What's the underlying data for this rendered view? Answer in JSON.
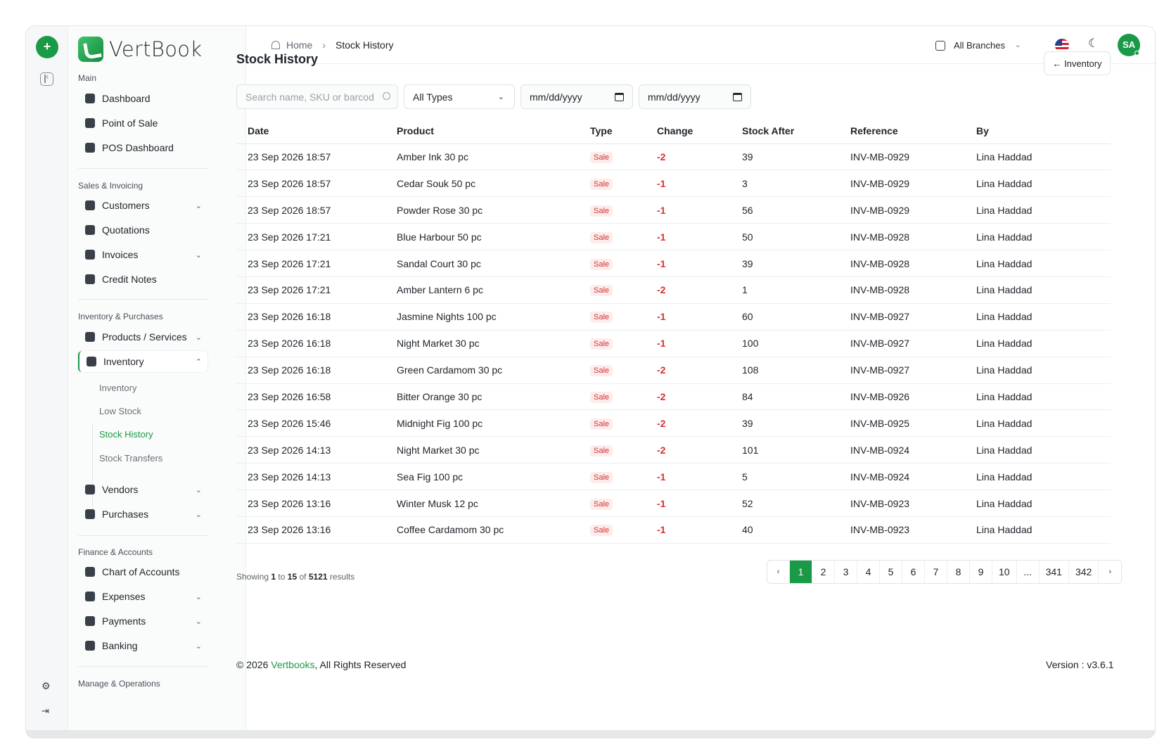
{
  "brand": {
    "name": "VertBook"
  },
  "sidebar": {
    "sections": [
      {
        "title": "Main"
      },
      {
        "title": "Sales & Invoicing"
      },
      {
        "title": "Inventory & Purchases"
      },
      {
        "title": "Finance & Accounts"
      },
      {
        "title": "Manage & Operations"
      }
    ],
    "items": [
      {
        "label": "Dashboard",
        "icon": "grid-icon"
      },
      {
        "label": "Point of Sale",
        "icon": "pos-icon"
      },
      {
        "label": "POS Dashboard",
        "icon": "chart-icon"
      },
      {
        "label": "Customers",
        "icon": "users-icon"
      },
      {
        "label": "Quotations",
        "icon": "quote-icon"
      },
      {
        "label": "Invoices",
        "icon": "invoice-icon"
      },
      {
        "label": "Credit Notes",
        "icon": "credit-note-icon"
      },
      {
        "label": "Products / Services",
        "icon": "box-icon"
      },
      {
        "label": "Inventory",
        "icon": "inventory-icon"
      },
      {
        "label": "Vendors",
        "icon": "vendor-icon"
      },
      {
        "label": "Purchases",
        "icon": "bag-icon"
      },
      {
        "label": "Chart of Accounts",
        "icon": "accounts-icon"
      },
      {
        "label": "Expenses",
        "icon": "expense-icon"
      },
      {
        "label": "Payments",
        "icon": "payment-icon"
      },
      {
        "label": "Banking",
        "icon": "bank-icon"
      }
    ],
    "inventory_sub": [
      {
        "label": "Inventory"
      },
      {
        "label": "Low Stock"
      },
      {
        "label": "Stock History"
      },
      {
        "label": "Stock Transfers"
      }
    ]
  },
  "header": {
    "breadcrumb_home": "Home",
    "breadcrumb_current": "Stock History",
    "branch": "All Branches",
    "avatar": "SA"
  },
  "page": {
    "title": "Stock History",
    "back_button": "← Inventory"
  },
  "filters": {
    "search_placeholder": "Search name, SKU or barcod",
    "type_value": "All Types",
    "date_from": "mm/dd/yyyy",
    "date_to": "mm/dd/yyyy"
  },
  "table": {
    "columns": [
      "Date",
      "Product",
      "Type",
      "Change",
      "Stock After",
      "Reference",
      "By"
    ],
    "rows": [
      [
        "23 Sep 2026 18:57",
        "Amber Ink 30 pc",
        "Sale",
        "-2",
        "39",
        "INV-MB-0929",
        "Lina Haddad"
      ],
      [
        "23 Sep 2026 18:57",
        "Cedar Souk 50 pc",
        "Sale",
        "-1",
        "3",
        "INV-MB-0929",
        "Lina Haddad"
      ],
      [
        "23 Sep 2026 18:57",
        "Powder Rose 30 pc",
        "Sale",
        "-1",
        "56",
        "INV-MB-0929",
        "Lina Haddad"
      ],
      [
        "23 Sep 2026 17:21",
        "Blue Harbour 50 pc",
        "Sale",
        "-1",
        "50",
        "INV-MB-0928",
        "Lina Haddad"
      ],
      [
        "23 Sep 2026 17:21",
        "Sandal Court 30 pc",
        "Sale",
        "-1",
        "39",
        "INV-MB-0928",
        "Lina Haddad"
      ],
      [
        "23 Sep 2026 17:21",
        "Amber Lantern 6 pc",
        "Sale",
        "-2",
        "1",
        "INV-MB-0928",
        "Lina Haddad"
      ],
      [
        "23 Sep 2026 16:18",
        "Jasmine Nights 100 pc",
        "Sale",
        "-1",
        "60",
        "INV-MB-0927",
        "Lina Haddad"
      ],
      [
        "23 Sep 2026 16:18",
        "Night Market 30 pc",
        "Sale",
        "-1",
        "100",
        "INV-MB-0927",
        "Lina Haddad"
      ],
      [
        "23 Sep 2026 16:18",
        "Green Cardamom 30 pc",
        "Sale",
        "-2",
        "108",
        "INV-MB-0927",
        "Lina Haddad"
      ],
      [
        "23 Sep 2026 16:58",
        "Bitter Orange 30 pc",
        "Sale",
        "-2",
        "84",
        "INV-MB-0926",
        "Lina Haddad"
      ],
      [
        "23 Sep 2026 15:46",
        "Midnight Fig 100 pc",
        "Sale",
        "-2",
        "39",
        "INV-MB-0925",
        "Lina Haddad"
      ],
      [
        "23 Sep 2026 14:13",
        "Night Market 30 pc",
        "Sale",
        "-2",
        "101",
        "INV-MB-0924",
        "Lina Haddad"
      ],
      [
        "23 Sep 2026 14:13",
        "Sea Fig 100 pc",
        "Sale",
        "-1",
        "5",
        "INV-MB-0924",
        "Lina Haddad"
      ],
      [
        "23 Sep 2026 13:16",
        "Winter Musk 12 pc",
        "Sale",
        "-1",
        "52",
        "INV-MB-0923",
        "Lina Haddad"
      ],
      [
        "23 Sep 2026 13:16",
        "Coffee Cardamom 30 pc",
        "Sale",
        "-1",
        "40",
        "INV-MB-0923",
        "Lina Haddad"
      ]
    ]
  },
  "pagination": {
    "showing_prefix": "Showing",
    "from": "1",
    "to_word": "to",
    "to": "15",
    "of_word": "of",
    "total": "5121",
    "suffix": "results",
    "prev": "‹",
    "next": "›",
    "pages": [
      "1",
      "2",
      "3",
      "4",
      "5",
      "6",
      "7",
      "8",
      "9",
      "10",
      "...",
      "341",
      "342"
    ]
  },
  "footer": {
    "copyright_prefix": "© 2026",
    "brand_link": "Vertbooks",
    "rights": ", All Rights Reserved",
    "version": "Version : v3.6.1"
  },
  "colors": {
    "accent": "#1a9a47",
    "negative": "#d83030"
  }
}
